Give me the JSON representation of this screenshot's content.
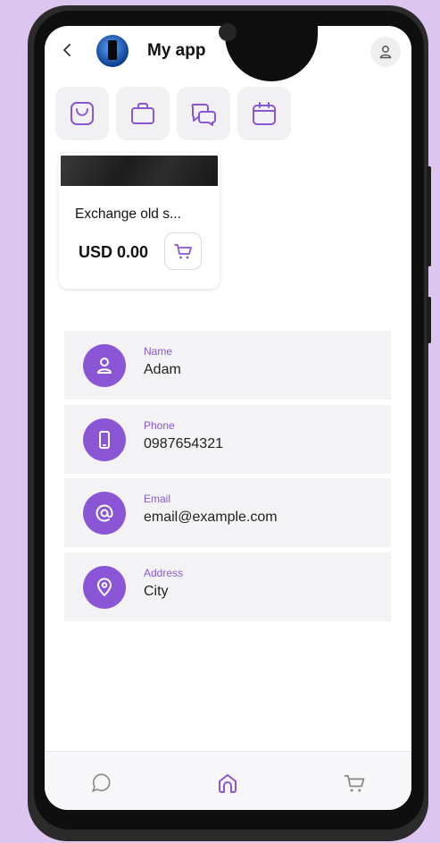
{
  "header": {
    "app_title": "My app",
    "back_icon": "chevron-left-icon",
    "profile_icon": "user-icon"
  },
  "quick_actions": [
    {
      "icon": "shopping-bag-icon"
    },
    {
      "icon": "briefcase-icon"
    },
    {
      "icon": "chat-bubbles-icon"
    },
    {
      "icon": "calendar-icon"
    }
  ],
  "product": {
    "title": "Exchange old s...",
    "price": "USD 0.00",
    "cart_icon": "cart-icon"
  },
  "contact": {
    "name": {
      "label": "Name",
      "value": "Adam",
      "icon": "user-icon"
    },
    "phone": {
      "label": "Phone",
      "value": "0987654321",
      "icon": "smartphone-icon"
    },
    "email": {
      "label": "Email",
      "value": "email@example.com",
      "icon": "at-icon"
    },
    "address": {
      "label": "Address",
      "value": "City",
      "icon": "map-pin-icon"
    }
  },
  "bottom_nav": [
    {
      "icon": "chat-icon"
    },
    {
      "icon": "home-icon",
      "active": true
    },
    {
      "icon": "cart-icon"
    }
  ],
  "colors": {
    "accent": "#8a56d6",
    "background": "#dcc5ef",
    "row_bg": "#f3f3f5"
  }
}
